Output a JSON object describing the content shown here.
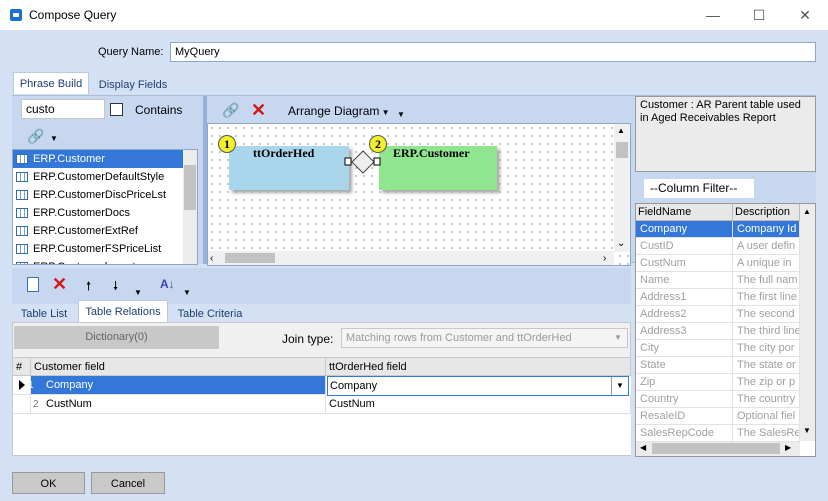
{
  "window": {
    "title": "Compose Query",
    "minimize": "—",
    "maximize": "☐",
    "close": "✕"
  },
  "query": {
    "label": "Query Name:",
    "value": "MyQuery"
  },
  "top_tabs": [
    "Phrase Build",
    "Display Fields"
  ],
  "search": {
    "value": "custo",
    "contains_label": "Contains",
    "contains_checked": false
  },
  "table_list": [
    "ERP.Customer",
    "ERP.CustomerDefaultStyle",
    "ERP.CustomerDiscPriceLst",
    "ERP.CustomerDocs",
    "ERP.CustomerExtRef",
    "ERP.CustomerFSPriceList",
    "ERP.Customerlmport"
  ],
  "table_list_selected": 0,
  "diagram": {
    "arrange_label": "Arrange Diagram",
    "tables": [
      {
        "badge": "1",
        "name": "ttOrderHed",
        "color": "#a9d6ea"
      },
      {
        "badge": "2",
        "name": "ERP.Customer",
        "color": "#8fe68f"
      }
    ]
  },
  "description": "Customer : AR Parent table used in Aged Receivables Report",
  "column_filter": "--Column Filter--",
  "field_grid": {
    "headers": [
      "FieldName",
      "Description"
    ],
    "rows": [
      [
        "Company",
        "Company Id"
      ],
      [
        "CustID",
        "A user defin"
      ],
      [
        "CustNum",
        "A  unique in"
      ],
      [
        "Name",
        "The full nam"
      ],
      [
        "Address1",
        "The first line"
      ],
      [
        "Address2",
        "The second"
      ],
      [
        "Address3",
        "The third line"
      ],
      [
        "City",
        "The city por"
      ],
      [
        "State",
        "The state or"
      ],
      [
        "Zip",
        "The zip or p"
      ],
      [
        "Country",
        "The country"
      ],
      [
        "ResaleID",
        "Optional fiel"
      ],
      [
        "SalesRepCode",
        "The SalesRe"
      ]
    ]
  },
  "bottom_tabs": [
    "Table List",
    "Table Relations",
    "Table Criteria"
  ],
  "relations": {
    "dictionary_label": "Dictionary(0)",
    "join_label": "Join type:",
    "join_value": "Matching rows from Customer and ttOrderHed",
    "headers": [
      "#",
      "Customer field",
      "ttOrderHed field"
    ],
    "rows": [
      [
        "1",
        "Company",
        "Company"
      ],
      [
        "2",
        "CustNum",
        "CustNum"
      ]
    ]
  },
  "buttons": {
    "ok": "OK",
    "cancel": "Cancel"
  },
  "colors": {
    "accent": "#3377d8",
    "panel": "#d4e1f5",
    "delete": "#d21818"
  }
}
